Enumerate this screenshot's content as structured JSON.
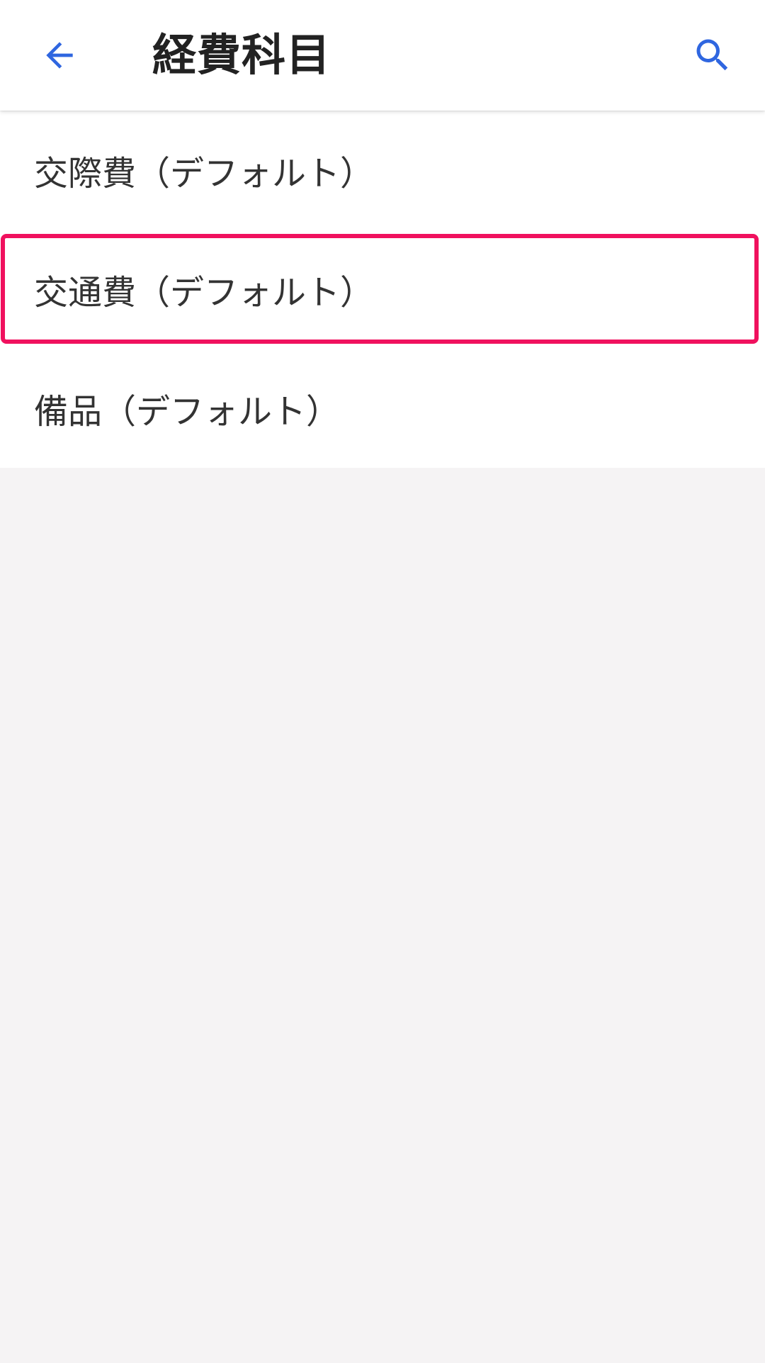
{
  "header": {
    "title": "経費科目",
    "back_icon": "arrow-left-icon",
    "search_icon": "search-icon",
    "accent_color": "#2f66e0"
  },
  "list": {
    "items": [
      {
        "label": "交際費（デフォルト）",
        "highlighted": false
      },
      {
        "label": "交通費（デフォルト）",
        "highlighted": true
      },
      {
        "label": "備品（デフォルト）",
        "highlighted": false
      }
    ]
  },
  "highlight_color": "#f0115e"
}
